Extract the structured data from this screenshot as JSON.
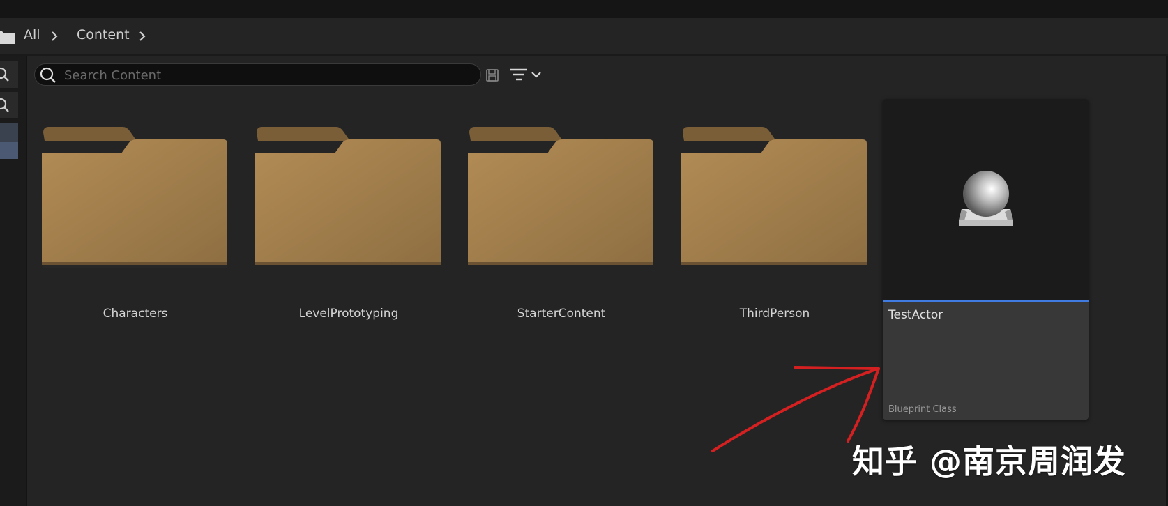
{
  "breadcrumb": {
    "items": [
      "All",
      "Content"
    ],
    "icon": "folder-icon"
  },
  "search": {
    "placeholder": "Search Content",
    "value": ""
  },
  "toolbar": {
    "save_icon": "save-icon",
    "filter_icon": "filter-icon"
  },
  "folders": [
    {
      "label": "Characters"
    },
    {
      "label": "LevelPrototyping"
    },
    {
      "label": "StarterContent"
    },
    {
      "label": "ThirdPerson"
    }
  ],
  "asset": {
    "name": "TestActor",
    "type": "Blueprint Class",
    "accent_color": "#3f7be0"
  },
  "annotation": {
    "arrow_color": "#d42020"
  },
  "watermark": {
    "text": "知乎 @南京周润发"
  },
  "colors": {
    "background": "#242424",
    "folder": "#a07c4c"
  }
}
